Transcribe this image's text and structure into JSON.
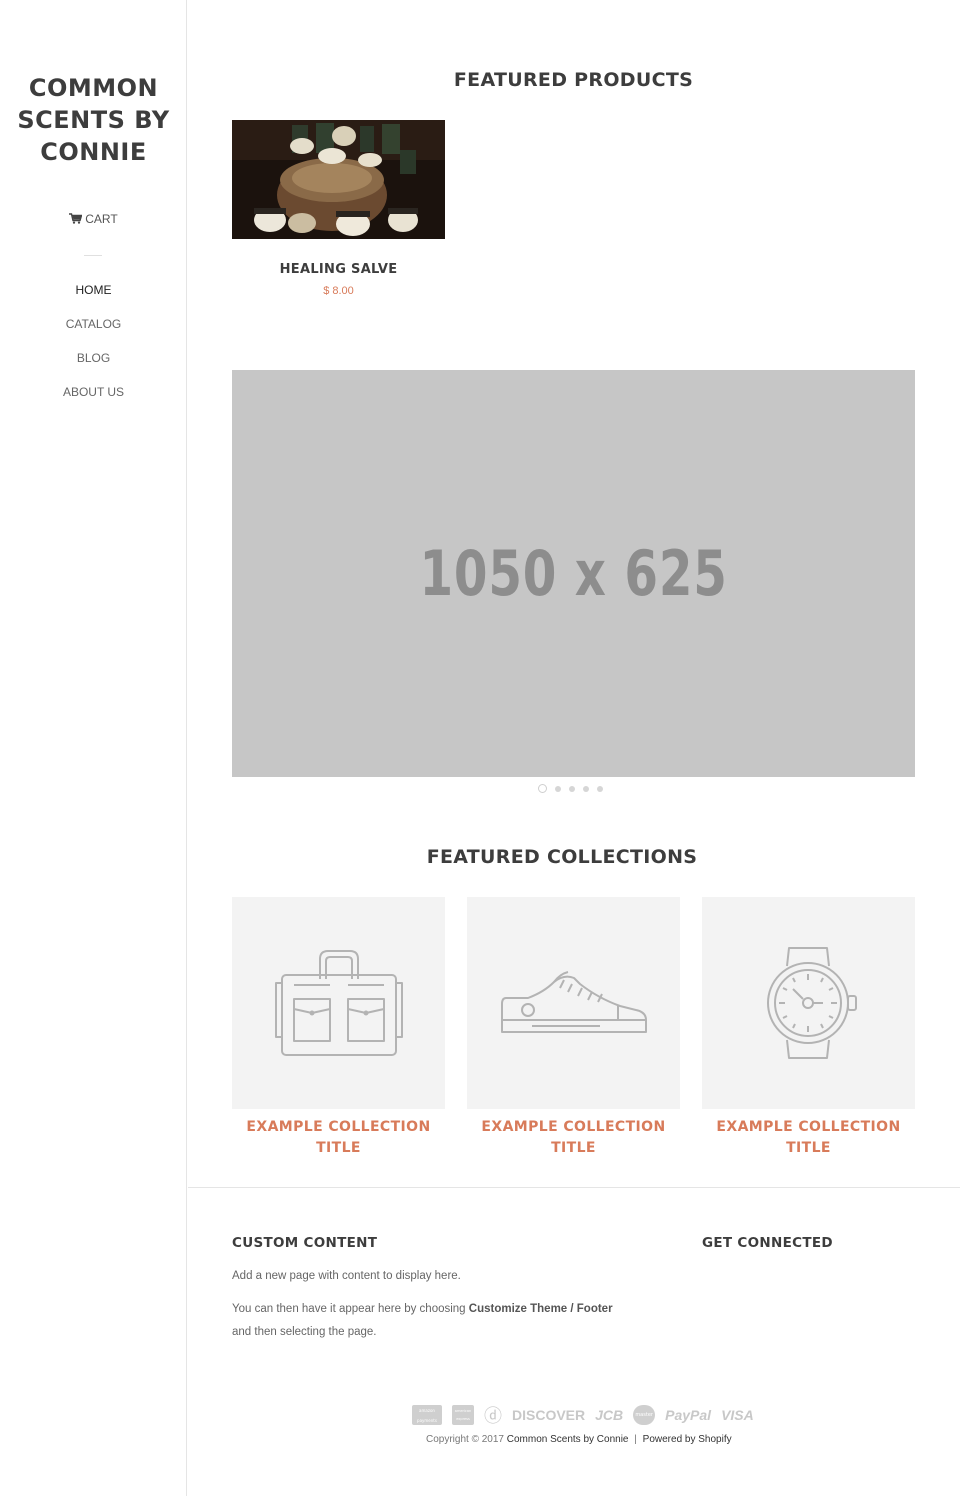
{
  "sidebar": {
    "logo_lines": [
      "COMMON",
      "SCENTS BY",
      "CONNIE"
    ],
    "cart_label": "CART",
    "nav": [
      {
        "label": "HOME"
      },
      {
        "label": "CATALOG"
      },
      {
        "label": "BLOG"
      },
      {
        "label": "ABOUT US"
      }
    ]
  },
  "featured_products": {
    "title": "FEATURED PRODUCTS",
    "items": [
      {
        "name": "HEALING SALVE",
        "price": "$ 8.00"
      }
    ]
  },
  "slideshow": {
    "placeholder_text": "1050 x 625",
    "dot_count": 5,
    "active_dot": 1
  },
  "featured_collections": {
    "title": "FEATURED COLLECTIONS",
    "items": [
      {
        "title_line1": "EXAMPLE COLLECTION",
        "title_line2": "TITLE",
        "icon": "bag-icon"
      },
      {
        "title_line1": "EXAMPLE COLLECTION",
        "title_line2": "TITLE",
        "icon": "shoe-icon"
      },
      {
        "title_line1": "EXAMPLE COLLECTION",
        "title_line2": "TITLE",
        "icon": "watch-icon"
      }
    ]
  },
  "footer": {
    "custom_title": "CUSTOM CONTENT",
    "custom_line1": "Add a new page with content to display here.",
    "custom_line2_pre": "You can then have it appear here by choosing ",
    "custom_line2_bold": "Customize Theme / Footer",
    "custom_line3": "and then selecting the page.",
    "connected_title": "GET CONNECTED",
    "payments": [
      "amazon payments",
      "american express",
      "diners",
      "DISCOVER",
      "JCB",
      "master",
      "PayPal",
      "VISA"
    ],
    "copyright_pre": "Copyright © 2017 ",
    "copyright_store": "Common Scents by Connie",
    "copyright_sep": "|",
    "copyright_powered": "Powered by Shopify"
  },
  "colors": {
    "accent": "#d87b5a",
    "heading": "#3d3d3d",
    "placeholder_bg": "#c6c6c6",
    "tile_bg": "#f3f3f3"
  }
}
